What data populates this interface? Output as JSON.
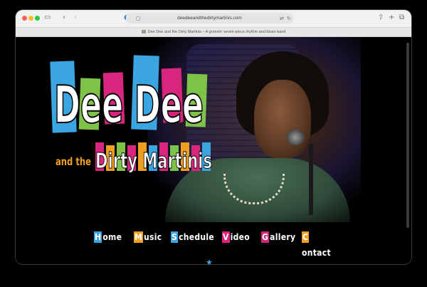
{
  "browser": {
    "url": "deedeeandthedirtymartinis.com",
    "tab_title": "Dee Dee and the Dirty Martinis – A groovin' seven-piece rhythm and blues band",
    "icons": [
      "sidebar-icon",
      "back-icon",
      "forward-icon",
      "privacy-icon",
      "share-icon",
      "new-tab-icon",
      "tabs-overview-icon"
    ]
  },
  "hero": {
    "logo_line1": "Dee Dee",
    "logo_line2_prefix": "and the",
    "logo_line2": "Dirty Martinis"
  },
  "nav": {
    "items": [
      {
        "label": "Home",
        "cap_color": "#3aa5e0"
      },
      {
        "label": "Music",
        "cap_color": "#f0a020"
      },
      {
        "label": "Schedule",
        "cap_color": "#3aa5e0"
      },
      {
        "label": "Video",
        "cap_color": "#e0207a"
      },
      {
        "label": "Gallery",
        "cap_color": "#d02878"
      },
      {
        "label": "Contact",
        "cap_color": "#f0a020"
      }
    ]
  },
  "colors": {
    "blue": "#3aa5e0",
    "green": "#7fc24a",
    "magenta": "#d8267e",
    "orange": "#f0a020",
    "divider": "#d08a1e"
  }
}
